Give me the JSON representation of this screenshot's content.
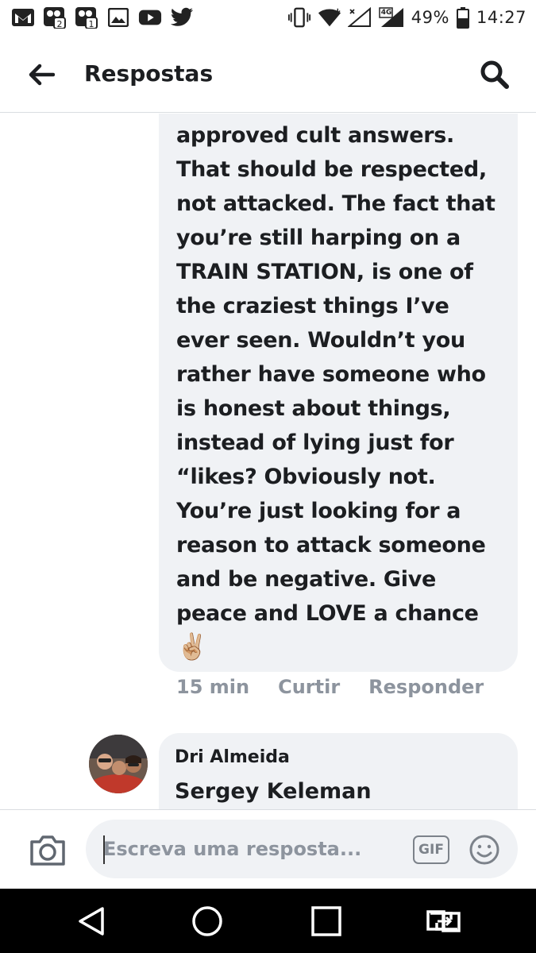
{
  "status_bar": {
    "icons_left": [
      "gmail-icon",
      "messenger-2-icon",
      "messenger-1-icon",
      "gallery-icon",
      "youtube-icon",
      "twitter-icon"
    ],
    "icons_right": [
      "vibrate-icon",
      "wifi-icon",
      "signal-icon",
      "signal-4g-icon",
      "battery-icon"
    ],
    "network_label": "4G",
    "battery": "49%",
    "time": "14:27"
  },
  "header": {
    "title": "Respostas",
    "back_icon": "arrow-left-icon",
    "search_icon": "search-icon"
  },
  "comment": {
    "text": "approved cult answers. That should be respected, not attacked. The fact that you’re still harping on a TRAIN STATION, is one of the craziest things I’ve ever seen. Wouldn’t you rather have someone who is honest about things, instead of lying just for “likes? Obviously not. You’re just looking for a reason to attack someone and be negative. Give peace and LOVE a chance",
    "emoji": "✌🏼",
    "time": "15 min",
    "like_label": "Curtir",
    "reply_label": "Responder"
  },
  "reply": {
    "author": "Dri Almeida",
    "text": "Sergey Keleman"
  },
  "composer": {
    "placeholder": "Escreva uma resposta...",
    "gif_label": "GIF",
    "camera_icon": "camera-icon",
    "emoji_icon": "smiley-icon"
  },
  "nav": {
    "icons": [
      "back-triangle-icon",
      "home-circle-icon",
      "recents-square-icon",
      "switch-apps-icon"
    ]
  },
  "colors": {
    "bubble": "#f0f2f5",
    "meta": "#8d949e",
    "text": "#1c1e21",
    "nav_bar": "#000000"
  }
}
